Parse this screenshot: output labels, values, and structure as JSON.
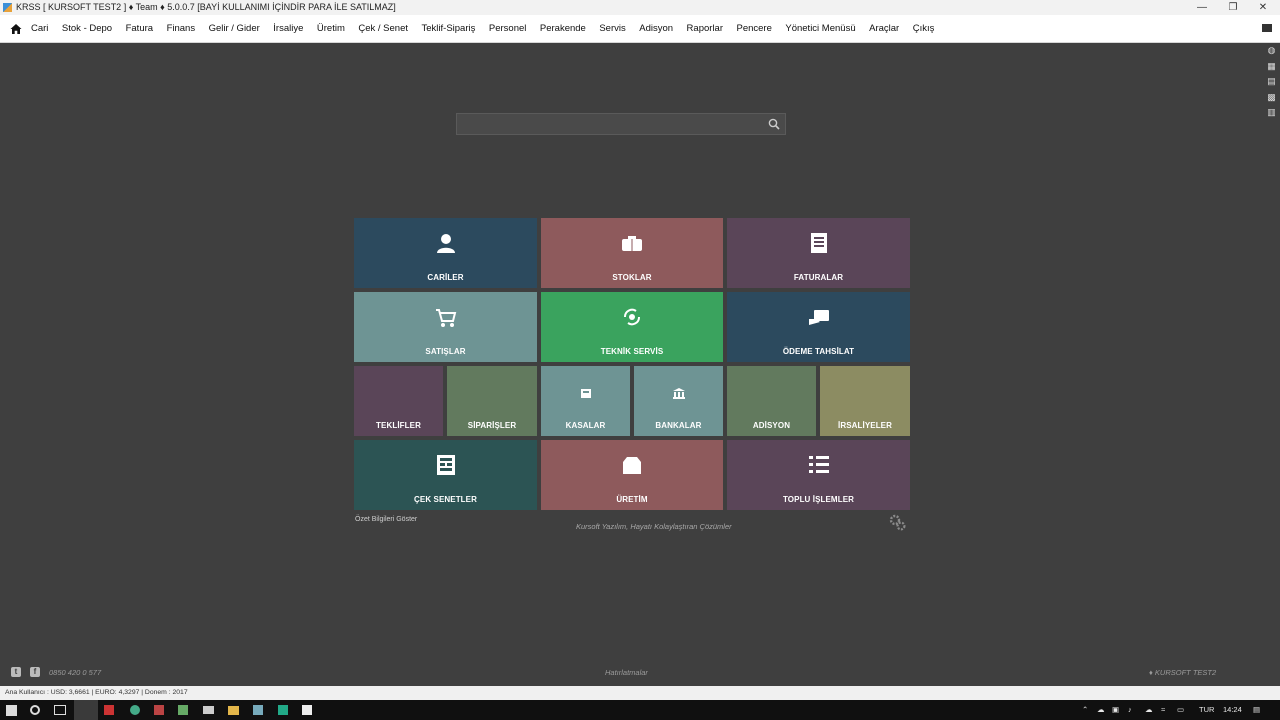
{
  "window": {
    "title": "KRSS [ KURSOFT TEST2 ] ♦ Team ♦ 5.0.0.7 [BAYİ KULLANIMI İÇİNDİR PARA İLE SATILMAZ]",
    "minimize": "—",
    "restore": "❐",
    "close": "✕"
  },
  "menu": {
    "items": [
      "Cari",
      "Stok - Depo",
      "Fatura",
      "Finans",
      "Gelir / Gider",
      "İrsaliye",
      "Üretim",
      "Çek / Senet",
      "Teklif-Sipariş",
      "Personel",
      "Perakende",
      "Servis",
      "Adisyon",
      "Raporlar",
      "Pencere",
      "Yönetici Menüsü",
      "Araçlar",
      "Çıkış"
    ]
  },
  "search": {
    "placeholder": "",
    "value": ""
  },
  "tiles": {
    "cariler": {
      "label": "CARİLER",
      "color": "#2c4a5e"
    },
    "stoklar": {
      "label": "STOKLAR",
      "color": "#8e5a5c"
    },
    "faturalar": {
      "label": "FATURALAR",
      "color": "#5a4558"
    },
    "satislar": {
      "label": "SATIŞLAR",
      "color": "#6e9494"
    },
    "teknik_servis": {
      "label": "TEKNİK SERVİS",
      "color": "#3aa35e"
    },
    "odeme_tahsilat": {
      "label": "ÖDEME TAHSİLAT",
      "color": "#2c4a5e"
    },
    "teklifler": {
      "label": "TEKLİFLER",
      "color": "#5a4558"
    },
    "siparisler": {
      "label": "SİPARİŞLER",
      "color": "#627a5e"
    },
    "kasalar": {
      "label": "KASALAR",
      "color": "#6e9494"
    },
    "bankalar": {
      "label": "BANKALAR",
      "color": "#6e9494"
    },
    "adisyon": {
      "label": "ADİSYON",
      "color": "#627a5e"
    },
    "irsaliyeler": {
      "label": "İRSALİYELER",
      "color": "#8c8c62"
    },
    "cek_senetler": {
      "label": "ÇEK SENETLER",
      "color": "#2c5454"
    },
    "uretim": {
      "label": "ÜRETİM",
      "color": "#8e5a5c"
    },
    "toplu_islemler": {
      "label": "TOPLU İŞLEMLER",
      "color": "#5a4558"
    }
  },
  "summary_link": "Özet Bilgileri Göster",
  "slogan": "Kursoft Yazılım, Hayatı Kolaylaştıran Çözümler",
  "phone": "0850 420 0 577",
  "reminders": "Hatırlatmalar",
  "company": "♦ KURSOFT TEST2",
  "status": "Ana Kullanıcı :  USD: 3,6661  | EURO: 4,3297   | Donem : 2017",
  "tray": {
    "language": "TUR",
    "time": "14:24"
  },
  "colors": {
    "background": "#3f3f3f",
    "menubar": "#ffffff",
    "taskbar": "#101010"
  }
}
